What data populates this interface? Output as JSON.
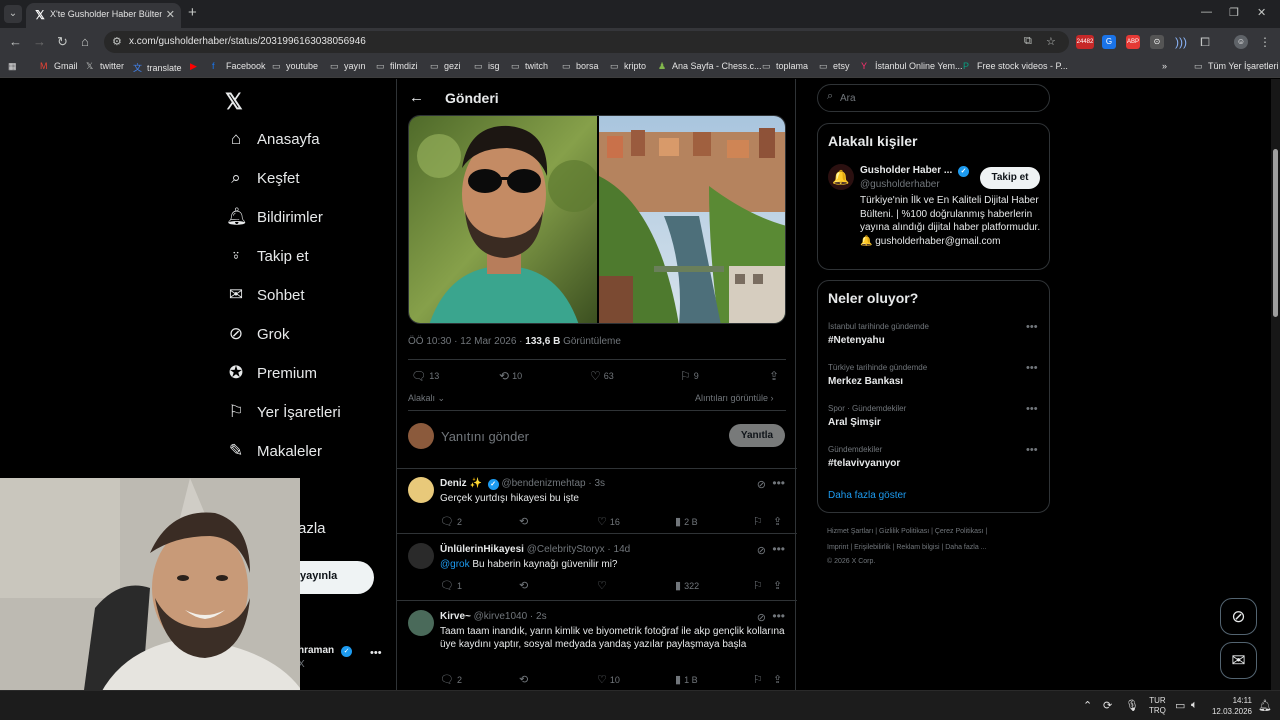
{
  "browser": {
    "tab_title": "X'te Gusholder Haber Bülteni: \"",
    "url": "x.com/gusholderhaber/status/2031996163038056946",
    "ext_badge": "24482",
    "bookmarks": [
      "Gmail",
      "twitter",
      "translate",
      "Facebook",
      "youtube",
      "yayın",
      "filmdizi",
      "gezi",
      "isg",
      "twitch",
      "borsa",
      "kripto",
      "Ana Sayfa - Chess.c...",
      "toplama",
      "etsy",
      "İstanbul Online Yem...",
      "Free stock videos - P..."
    ],
    "all_bookmarks": "Tüm Yer İşaretleri"
  },
  "nav": {
    "items": [
      "Anasayfa",
      "Keşfet",
      "Bildirimler",
      "Takip et",
      "Sohbet",
      "Grok",
      "Premium",
      "Yer İşaretleri",
      "Makaleler"
    ],
    "more_label": "azla",
    "post_button": "yayınla",
    "account_name": "hraman",
    "account_handle": "X"
  },
  "post": {
    "header_title": "Gönderi",
    "time": "ÖÖ 10:30 · 12 Mar 2026 · ",
    "views": "133,6 B",
    "views_label": "Görüntüleme",
    "replies": "13",
    "reposts": "10",
    "likes": "63",
    "bookmarks": "9",
    "sort_label": "Alakalı",
    "quotes_label": "Alıntıları görüntüle",
    "reply_placeholder": "Yanıtını gönder",
    "reply_button": "Yanıtla"
  },
  "replies": [
    {
      "name": "Deniz ✨",
      "handle": "@bendenizmehtap · 3s",
      "mention": "",
      "text": "Gerçek yurtdışı hikayesi bu işte",
      "replies": "2",
      "reposts": "",
      "likes": "16",
      "views": "2 B"
    },
    {
      "name": "ÜnlülerinHikayesi",
      "handle": "@CelebrityStoryx · 14d",
      "mention": "@grok",
      "text": " Bu haberin kaynağı güvenilir mi?",
      "replies": "1",
      "reposts": "",
      "likes": "",
      "views": "322"
    },
    {
      "name": "Kirve~",
      "handle": "@kirve1040 · 2s",
      "mention": "",
      "text": "Taam taam inandık, yarın kimlik ve biyometrik fotoğraf ile akp gençlik kollarına üye kaydını yaptır, sosyal medyada yandaş yazılar paylaşmaya başla",
      "replies": "2",
      "reposts": "",
      "likes": "10",
      "views": "1 B"
    }
  ],
  "sidebar": {
    "search_placeholder": "Ara",
    "related_title": "Alakalı kişiler",
    "related": {
      "name": "Gusholder Haber ...",
      "handle": "@gusholderhaber",
      "bio": "Türkiye'nin İlk ve En Kaliteli Dijital Haber Bülteni. | %100 doğrulanmış haberlerin yayına alındığı dijital haber platformudur. 🔔 gusholderhaber@gmail.com",
      "follow": "Takip et"
    },
    "trends_title": "Neler oluyor?",
    "trends": [
      {
        "context": "İstanbul tarihinde gündemde",
        "name": "#Netenyahu"
      },
      {
        "context": "Türkiye tarihinde gündemde",
        "name": "Merkez Bankası"
      },
      {
        "context": "Spor · Gündemdekiler",
        "name": "Aral Şimşir"
      },
      {
        "context": "Gündemdekiler",
        "name": "#telavivyanıyor"
      }
    ],
    "show_more": "Daha fazla göster",
    "footer_line1": "Hizmet Şartları  |  Gizlilik Politikası  |  Çerez Politikası  |",
    "footer_line2": "Imprint  |  Erişilebilirlik  |  Reklam bilgisi  |  Daha fazla ...",
    "footer_line3": "© 2026 X Corp."
  },
  "taskbar": {
    "lang_top": "TUR",
    "lang_bottom": "TRQ",
    "time": "14:11",
    "date": "12.03.2026"
  },
  "colors": {
    "accent": "#1d9bf0",
    "border": "#2f3336",
    "muted": "#71767b"
  }
}
